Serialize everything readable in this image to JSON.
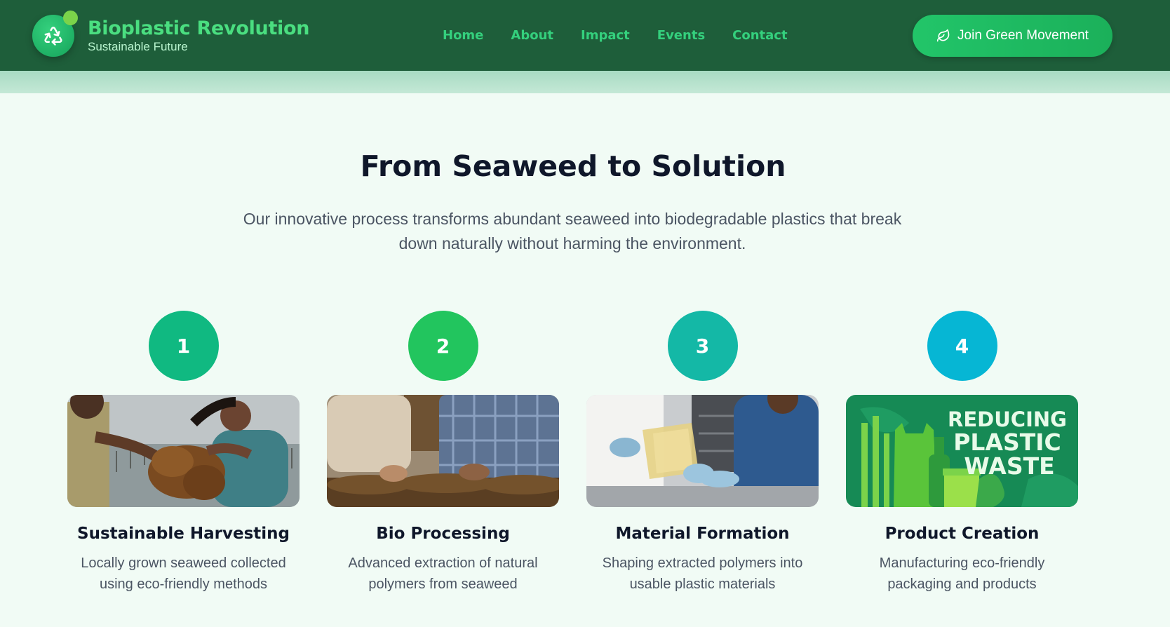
{
  "header": {
    "brand_title": "Bioplastic Revolution",
    "brand_subtitle": "Sustainable Future",
    "logo_icon": "recycle-icon",
    "nav": [
      {
        "label": "Home"
      },
      {
        "label": "About"
      },
      {
        "label": "Impact"
      },
      {
        "label": "Events"
      },
      {
        "label": "Contact"
      }
    ],
    "cta_label": "Join Green Movement",
    "cta_icon": "leaf-icon"
  },
  "hero": {
    "title": "From Seaweed to Solution",
    "description": "Our innovative process transforms abundant seaweed into biodegradable plastics that break down naturally without harming the environment."
  },
  "steps": [
    {
      "number": "1",
      "title": "Sustainable Harvesting",
      "text": "Locally grown seaweed collected using eco-friendly methods",
      "color": "#10b981"
    },
    {
      "number": "2",
      "title": "Bio Processing",
      "text": "Advanced extraction of natural polymers from seaweed",
      "color": "#22c55e"
    },
    {
      "number": "3",
      "title": "Material Formation",
      "text": "Shaping extracted polymers into usable plastic materials",
      "color": "#14b8a6"
    },
    {
      "number": "4",
      "title": "Product Creation",
      "text": "Manufacturing eco-friendly packaging and products",
      "color": "#06b6d4",
      "image_text": [
        "REDUCING",
        "PLASTIC",
        "WASTE"
      ]
    }
  ],
  "colors": {
    "header_bg": "#1e5e3a",
    "accent": "#22c569",
    "page_bg": "#f1fbf5"
  }
}
